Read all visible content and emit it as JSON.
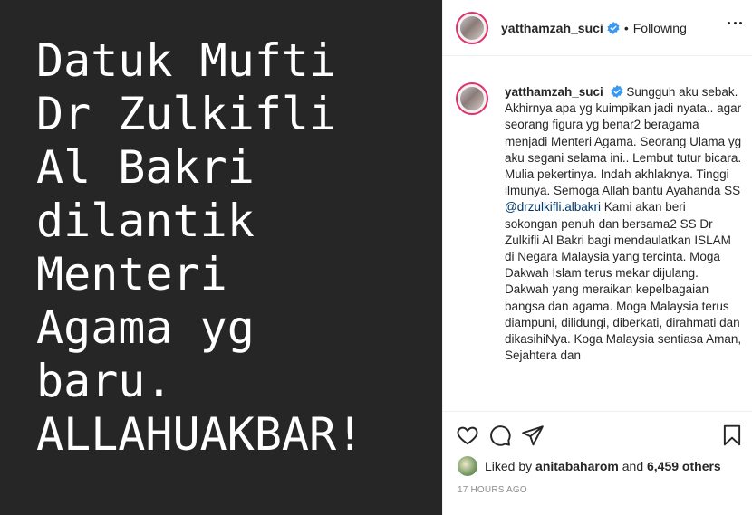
{
  "image": {
    "lines": [
      "Datuk Mufti",
      "Dr Zulkifli",
      "Al Bakri",
      "dilantik",
      "Menteri",
      "Agama yg",
      "baru.",
      "ALLAHUAKBAR!"
    ]
  },
  "header": {
    "username": "yatthamzah_suci",
    "separator": "•",
    "follow_status": "Following"
  },
  "caption": {
    "username": "yatthamzah_suci",
    "text_before": " Sungguh aku sebak. Akhirnya apa yg kuimpikan jadi nyata.. agar seorang figura yg benar2 beragama menjadi Menteri Agama. Seorang Ulama yg aku segani selama ini.. Lembut tutur bicara. Mulia pekertinya. Indah akhlaknya. Tinggi ilmunya. Semoga Allah bantu Ayahanda SS ",
    "mention": "@drzulkifli.albakri",
    "text_after": " Kami akan beri sokongan penuh dan bersama2 SS Dr Zulkifli Al Bakri bagi mendaulatkan ISLAM di Negara Malaysia yang tercinta. Moga Dakwah Islam terus mekar dijulang. Dakwah yang meraikan kepelbagaian bangsa dan agama. Moga Malaysia terus diampuni, dilidungi, diberkati, dirahmati dan dikasihiNya. Koga Malaysia sentiasa Aman, Sejahtera dan"
  },
  "likes": {
    "prefix": "Liked by ",
    "user": "anitabaharom",
    "middle": " and ",
    "count": "6,459 others"
  },
  "timestamp": "17 HOURS AGO",
  "colors": {
    "image_bg": "#262626",
    "verified": "#3897f0",
    "mention": "#003569",
    "muted": "#8e8e8e"
  },
  "icons": [
    "heart-icon",
    "comment-icon",
    "share-icon",
    "bookmark-icon",
    "verified-icon",
    "more-icon"
  ]
}
